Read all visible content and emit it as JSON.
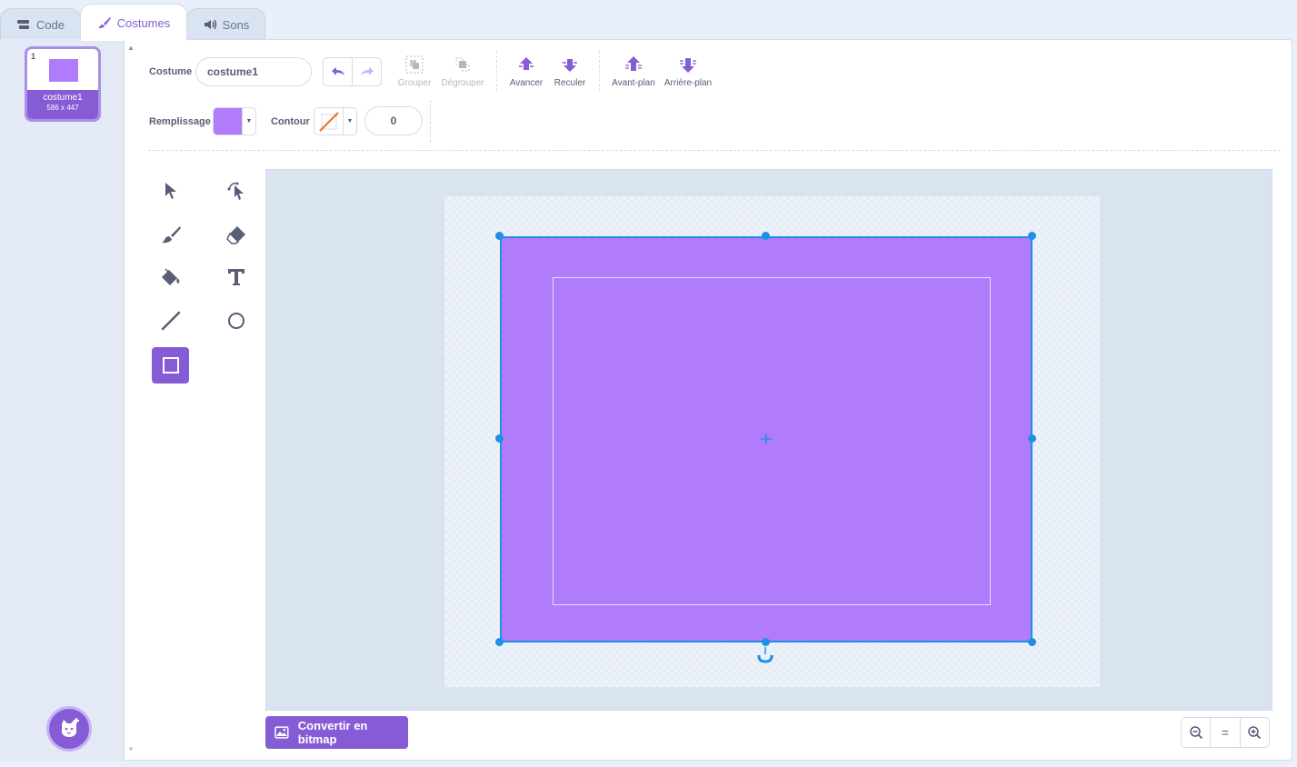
{
  "tabs": [
    {
      "label": "Code",
      "icon": "code-blocks-icon"
    },
    {
      "label": "Costumes",
      "icon": "brush-icon",
      "active": true
    },
    {
      "label": "Sons",
      "icon": "speaker-icon"
    }
  ],
  "costumes": [
    {
      "number": "1",
      "name": "costume1",
      "size": "586 x 447",
      "selected": true
    }
  ],
  "toolbar": {
    "costume_label": "Costume",
    "costume_name": "costume1",
    "group": "Grouper",
    "ungroup": "Dégrouper",
    "forward": "Avancer",
    "backward": "Reculer",
    "front": "Avant-plan",
    "back": "Arrière-plan",
    "fill_label": "Remplissage",
    "fill_color": "#b07cfc",
    "outline_label": "Contour",
    "outline_color": "none",
    "outline_width": "0"
  },
  "tools": [
    "select-tool",
    "reshape-tool",
    "brush-tool",
    "eraser-tool",
    "fill-tool",
    "text-tool",
    "line-tool",
    "circle-tool",
    "rectangle-tool"
  ],
  "active_tool": "rectangle-tool",
  "canvas": {
    "shape_color": "#b07cfc",
    "selection_color": "#1e90e6"
  },
  "bottom": {
    "convert_label": "Convertir en bitmap",
    "zoom_out": "zoom-out-icon",
    "zoom_reset": "=",
    "zoom_in": "zoom-in-icon"
  },
  "colors": {
    "accent": "#855cd6",
    "bg": "#e8f0fb"
  }
}
